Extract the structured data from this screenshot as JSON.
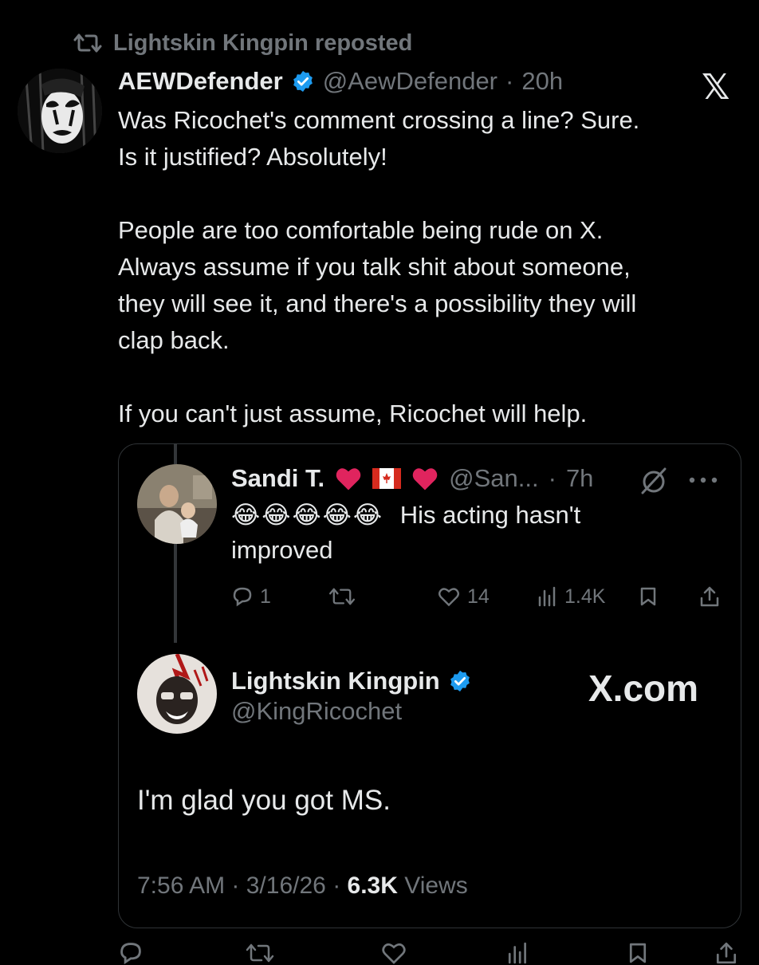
{
  "repost": {
    "label": "Lightskin Kingpin reposted",
    "icon": "retweet-icon"
  },
  "tweet": {
    "author_name": "AEWDefender",
    "handle": "@AewDefender",
    "separator": "·",
    "time": "20h",
    "lines": [
      "Was Ricochet's comment crossing a line? Sure.",
      "Is it justified? Absolutely!",
      "",
      "People are too comfortable being rude on X.",
      "Always assume if you talk shit about someone,",
      "they will see it, and there's a possibility they will",
      "clap back.",
      "",
      "If you can't just assume, Ricochet will help."
    ]
  },
  "brand": {
    "x_logo": "𝕏",
    "accent": "#1d9bf0",
    "heart": "#e0245e"
  },
  "sandi": {
    "name": "Sandi T.",
    "handle": "@San...",
    "separator": "·",
    "time": "7h",
    "emojis": "😂😂😂😂😂",
    "text_inline": "His acting hasn't",
    "text_wrap": "improved",
    "replies": "1",
    "likes": "14",
    "views": "1.4K"
  },
  "kingpin": {
    "name": "Lightskin Kingpin",
    "handle": "@KingRicochet",
    "site": "X.com",
    "text": "I'm glad you got MS.",
    "time": "7:56 AM",
    "date": "3/16/26",
    "views_count": "6.3K",
    "views_label": "Views"
  }
}
